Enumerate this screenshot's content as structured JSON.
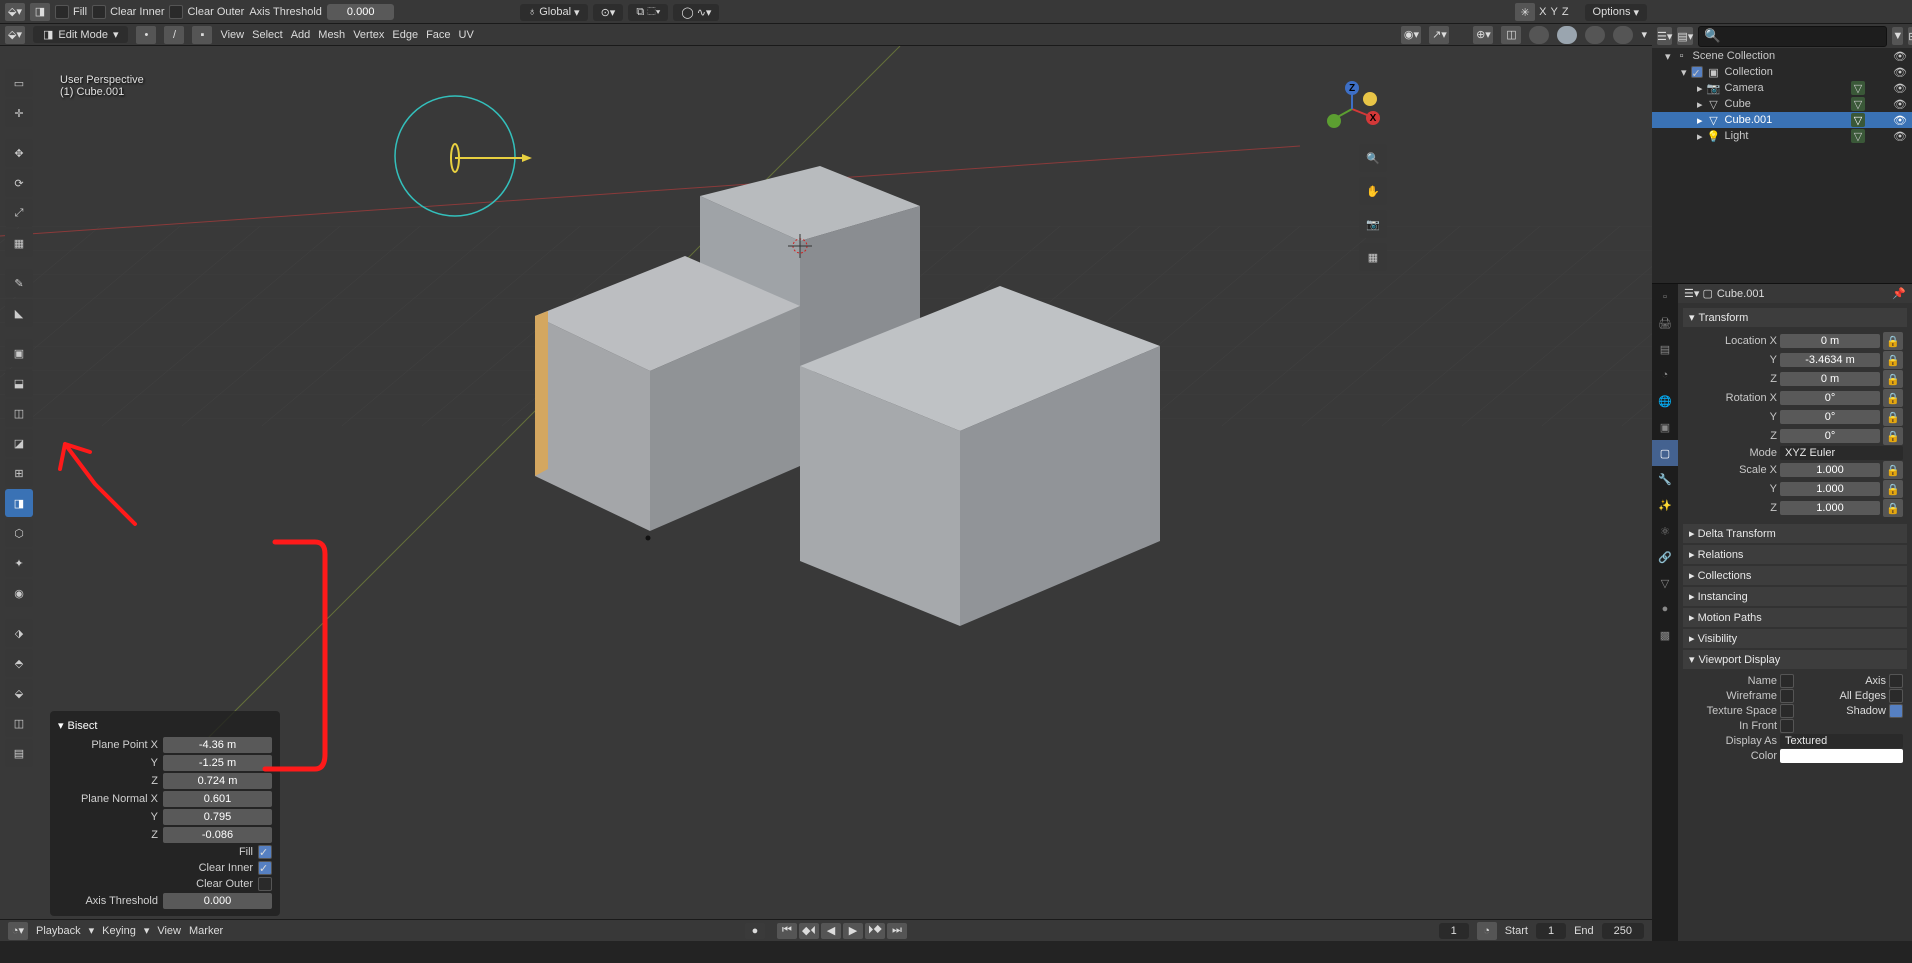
{
  "tool_settings": {
    "fill_label": "Fill",
    "clear_inner_label": "Clear Inner",
    "clear_outer_label": "Clear Outer",
    "axis_threshold_label": "Axis Threshold",
    "axis_threshold_value": "0.000",
    "orientation": "Global",
    "options_label": "Options"
  },
  "header": {
    "mode": "Edit Mode",
    "menus": [
      "View",
      "Select",
      "Add",
      "Mesh",
      "Vertex",
      "Edge",
      "Face",
      "UV"
    ],
    "xyz": [
      "X",
      "Y",
      "Z"
    ]
  },
  "overlay": {
    "line1": "User Perspective",
    "line2": "(1) Cube.001"
  },
  "toolbar": [
    {
      "name": "select-box-tool",
      "glyph": "▭"
    },
    {
      "name": "cursor-tool",
      "glyph": "✛"
    },
    {
      "name": "move-tool",
      "glyph": "✥"
    },
    {
      "name": "rotate-tool",
      "glyph": "⟳"
    },
    {
      "name": "scale-tool",
      "glyph": "⤢"
    },
    {
      "name": "transform-tool",
      "glyph": "▦"
    },
    {
      "name": "annotate-tool",
      "glyph": "✎"
    },
    {
      "name": "measure-tool",
      "glyph": "◣"
    },
    {
      "name": "add-cube-tool",
      "glyph": "▣"
    },
    {
      "name": "extrude-tool",
      "glyph": "⬓"
    },
    {
      "name": "inset-tool",
      "glyph": "◫"
    },
    {
      "name": "bevel-tool",
      "glyph": "◪"
    },
    {
      "name": "loop-cut-tool",
      "glyph": "⊞"
    },
    {
      "name": "bisect-tool",
      "glyph": "◨",
      "active": true
    },
    {
      "name": "knife-tool",
      "glyph": "⬡"
    },
    {
      "name": "poly-build-tool",
      "glyph": "✦"
    },
    {
      "name": "spin-tool",
      "glyph": "◉"
    },
    {
      "name": "smooth-tool",
      "glyph": "⬗"
    },
    {
      "name": "edge-slide-tool",
      "glyph": "⬘"
    },
    {
      "name": "shrink-tool",
      "glyph": "⬙"
    },
    {
      "name": "shear-tool",
      "glyph": "◫"
    },
    {
      "name": "rip-tool",
      "glyph": "▤"
    }
  ],
  "redo_panel": {
    "title": "Bisect",
    "rows": [
      {
        "label": "Plane Point X",
        "value": "-4.36 m"
      },
      {
        "label": "Y",
        "value": "-1.25 m"
      },
      {
        "label": "Z",
        "value": "0.724 m"
      },
      {
        "label": "Plane Normal X",
        "value": "0.601"
      },
      {
        "label": "Y",
        "value": "0.795"
      },
      {
        "label": "Z",
        "value": "-0.086"
      }
    ],
    "checks": [
      {
        "label": "Fill",
        "on": true
      },
      {
        "label": "Clear Inner",
        "on": true
      },
      {
        "label": "Clear Outer",
        "on": false
      }
    ],
    "threshold_label": "Axis Threshold",
    "threshold_value": "0.000"
  },
  "outliner": {
    "search_placeholder": "",
    "tree": [
      {
        "level": 0,
        "icon": "scene",
        "label": "Scene Collection"
      },
      {
        "level": 1,
        "icon": "collection",
        "label": "Collection",
        "checkbox": true
      },
      {
        "level": 2,
        "icon": "camera",
        "label": "Camera"
      },
      {
        "level": 2,
        "icon": "mesh",
        "label": "Cube"
      },
      {
        "level": 2,
        "icon": "mesh",
        "label": "Cube.001",
        "selected": true
      },
      {
        "level": 2,
        "icon": "light",
        "label": "Light"
      }
    ]
  },
  "properties": {
    "object_name": "Cube.001",
    "sections": {
      "transform": {
        "title": "Transform",
        "location_label": "Location X",
        "rotation_label": "Rotation X",
        "scale_label": "Scale X",
        "mode_label": "Mode",
        "mode_value": "XYZ Euler",
        "loc": [
          "0 m",
          "-3.4634 m",
          "0 m"
        ],
        "rot": [
          "0°",
          "0°",
          "0°"
        ],
        "scale": [
          "1.000",
          "1.000",
          "1.000"
        ]
      },
      "collapsed": [
        "Delta Transform",
        "Relations",
        "Collections",
        "Instancing",
        "Motion Paths",
        "Visibility"
      ],
      "viewport_display": {
        "title": "Viewport Display",
        "name_label": "Name",
        "axis_label": "Axis",
        "wireframe_label": "Wireframe",
        "all_edges_label": "All Edges",
        "texture_space_label": "Texture Space",
        "shadow_label": "Shadow",
        "in_front_label": "In Front",
        "display_as_label": "Display As",
        "display_as_value": "Textured",
        "color_label": "Color",
        "color_value": "#ffffff"
      }
    }
  },
  "timeline": {
    "menus": [
      "Playback",
      "Keying",
      "View",
      "Marker"
    ],
    "current_frame": "1",
    "start_label": "Start",
    "start": "1",
    "end_label": "End",
    "end": "250"
  }
}
